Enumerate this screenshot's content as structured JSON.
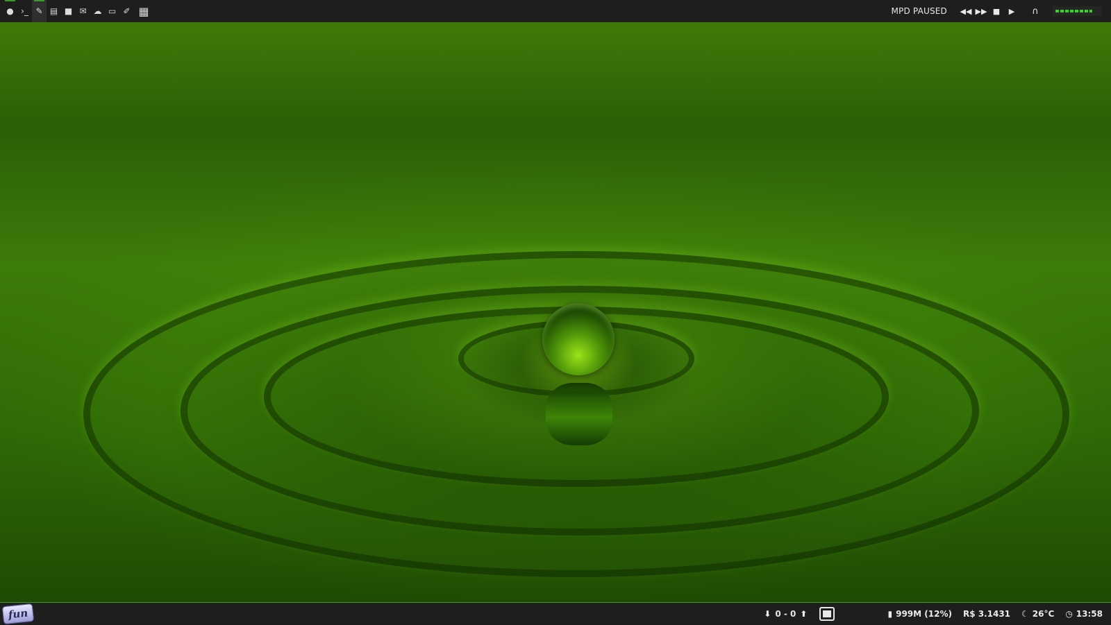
{
  "top_bar": {
    "launchers": [
      {
        "name": "system-menu-icon",
        "glyph": "●"
      },
      {
        "name": "terminal-icon",
        "glyph": "›_"
      },
      {
        "name": "editor-icon",
        "glyph": "✎"
      },
      {
        "name": "document-icon",
        "glyph": "▤"
      },
      {
        "name": "folder-icon",
        "glyph": "■"
      },
      {
        "name": "mail-icon",
        "glyph": "✉"
      },
      {
        "name": "chat-icon",
        "glyph": "☁"
      },
      {
        "name": "monitor-icon",
        "glyph": "▭"
      },
      {
        "name": "tools-icon",
        "glyph": "✐"
      },
      {
        "name": "grid-icon",
        "glyph": "▦"
      }
    ],
    "mpd_status": "MPD PAUSED",
    "media_controls": {
      "prev": "◀◀",
      "next": "▶▶",
      "stop": "■",
      "play": "▶",
      "headphones": "∩"
    },
    "volume_percent": 85,
    "accent_color": "#34d12c"
  },
  "bottom_bar": {
    "logo_text": "fun",
    "network": {
      "down_icon": "⬇",
      "value": "0 - 0",
      "up_icon": "⬆"
    },
    "memory": {
      "icon": "▮",
      "value": "999M (12%)"
    },
    "currency": {
      "value": "R$ 3.1431"
    },
    "weather": {
      "icon": "☾",
      "value": "26°C"
    },
    "clock": {
      "icon": "◷",
      "value": "13:58"
    }
  }
}
